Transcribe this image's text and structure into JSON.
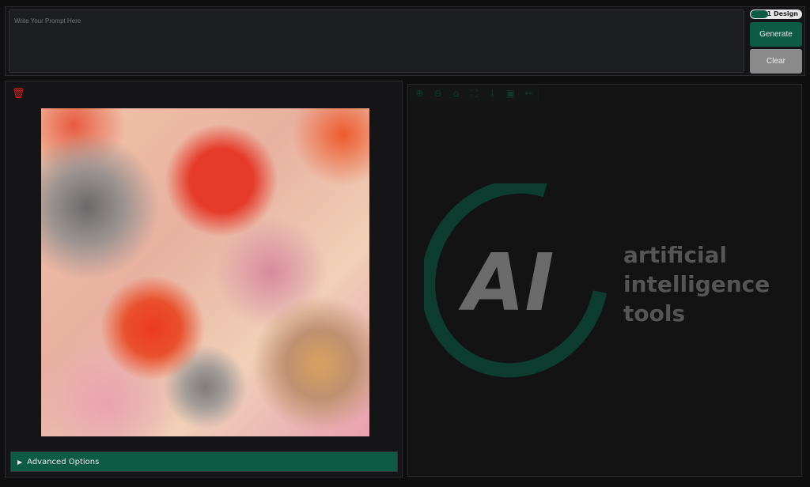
{
  "prompt": {
    "placeholder": "Write Your Prompt Here",
    "value": ""
  },
  "toggle": {
    "label": "1 Design",
    "on": true
  },
  "buttons": {
    "generate": "Generate",
    "clear": "Clear"
  },
  "gallery": {
    "delete_icon": "trash-icon",
    "image_alt": "watercolor flowers with ink splatters"
  },
  "advanced": {
    "label": "Advanced Options",
    "icon": "triangle-right"
  },
  "toolbar": {
    "icons": [
      "zoom-in-icon",
      "zoom-out-icon",
      "home-icon",
      "fullscreen-icon",
      "download-icon",
      "save-icon",
      "back-arrow-icon"
    ]
  },
  "logo": {
    "mark": "AI",
    "line1": "artificial",
    "line2": "intelligence",
    "line3": "tools",
    "color": "#0c3d2e"
  },
  "colors": {
    "accent": "#0d5b45",
    "delete": "#d32020"
  }
}
